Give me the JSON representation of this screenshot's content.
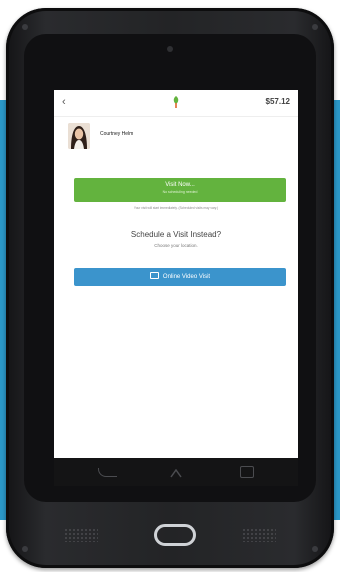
{
  "app": {
    "price": "$57.12"
  },
  "doctor": {
    "name": "Courtney Helm"
  },
  "visit_now": {
    "label": "Visit Now...",
    "sublabel": "No scheduling needed",
    "note": "Your visit will start immediately. (Scheduled visits may vary.)"
  },
  "schedule": {
    "title": "Schedule a Visit Instead?",
    "subtitle": "Choose your location.",
    "online_button": "Online Video Visit"
  },
  "colors": {
    "accent_blue": "#2b98c8",
    "visit_green": "#63b33e",
    "online_blue": "#3b94cc"
  },
  "icons": {
    "back": "back-arrow-icon",
    "logo": "leaf-logo-icon",
    "video": "video-icon",
    "nav_back": "nav-back-icon",
    "nav_home": "nav-home-icon",
    "nav_recents": "nav-recents-icon"
  }
}
